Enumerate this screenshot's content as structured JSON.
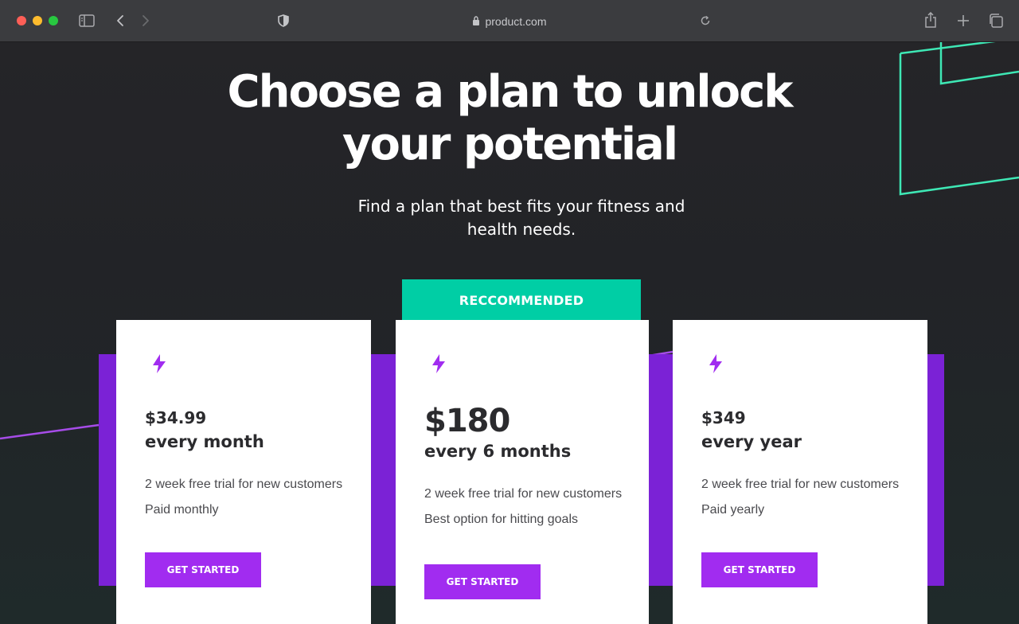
{
  "browser": {
    "url": "product.com"
  },
  "hero": {
    "title_line1": "Choose a plan to unlock",
    "title_line2": "your potential",
    "subtitle": "Find a plan that best fits your fitness and health needs."
  },
  "badge": "RECCOMMENDED",
  "plans": [
    {
      "price": "$34.99",
      "period": "every month",
      "features": [
        "2 week free trial for new customers",
        "Paid monthly"
      ],
      "cta": "GET STARTED"
    },
    {
      "price": "$180",
      "period": "every 6 months",
      "features": [
        "2 week free trial for new customers",
        "Best option for hitting goals"
      ],
      "cta": "GET STARTED",
      "recommended": true
    },
    {
      "price": "$349",
      "period": "every year",
      "features": [
        "2 week free trial for new customers",
        "Paid yearly"
      ],
      "cta": "GET STARTED"
    }
  ],
  "icons": {
    "plan": "lightning-bolt-icon"
  },
  "colors": {
    "accent_purple": "#a12cf0",
    "band_purple": "#7b22d6",
    "teal": "#00cea5",
    "decor_line_green": "#3ee8b5"
  }
}
